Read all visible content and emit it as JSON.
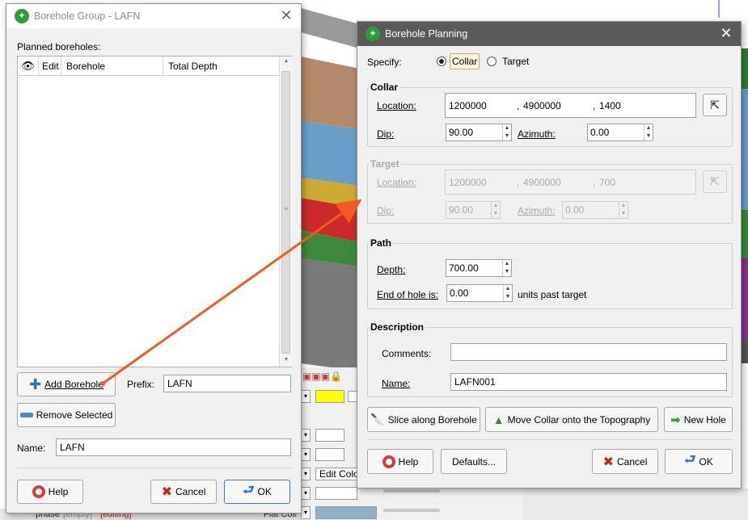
{
  "colors": {
    "accent_arrow": "#f05a23",
    "title_active": "#5a5a5a",
    "highlight_yellow": "#ffff00"
  },
  "bg_panel": {
    "edit_color_label": "Edit Colo",
    "phase_text": "phase",
    "empty_text": "[empty]",
    "editing_text": "[editing]",
    "flat_text": "Flat Coll"
  },
  "group_window": {
    "title": "Borehole Group - LAFN",
    "planned_label": "Planned boreholes:",
    "columns": [
      "Edit",
      "Borehole",
      "Total Depth"
    ],
    "eye_icon": "eye-icon",
    "add_button": "Add Borehole",
    "prefix_label": "Prefix:",
    "prefix_value": "LAFN",
    "remove_button": "Remove Selected",
    "name_label": "Name:",
    "name_value": "LAFN",
    "help_button": "Help",
    "cancel_button": "Cancel",
    "ok_button": "OK"
  },
  "planning_window": {
    "title": "Borehole Planning",
    "specify_label": "Specify:",
    "collar_option": "Collar",
    "target_option": "Target",
    "specify_selected": "Collar",
    "collar": {
      "heading": "Collar",
      "location_label": "Location:",
      "x": "1200000",
      "y": "4900000",
      "z": "1400",
      "dip_label": "Dip:",
      "dip": "90.00",
      "azimuth_label": "Azimuth:",
      "azimuth": "0.00"
    },
    "target": {
      "heading": "Target",
      "location_label": "Location:",
      "x": "1200000",
      "y": "4900000",
      "z": "700",
      "dip_label": "Dip:",
      "dip": "90.00",
      "azimuth_label": "Azimuth:",
      "azimuth": "0.00"
    },
    "path": {
      "heading": "Path",
      "depth_label": "Depth:",
      "depth": "700.00",
      "end_label": "End of hole is:",
      "end_value": "0.00",
      "units_label": "units past target"
    },
    "description": {
      "heading": "Description",
      "comments_label": "Comments:",
      "comments_value": "",
      "name_label": "Name:",
      "name_value": "LAFN001"
    },
    "slice_button": "Slice along Borehole",
    "move_button": "Move Collar onto the Topography",
    "new_hole_button": "New Hole",
    "help_button": "Help",
    "defaults_button": "Defaults...",
    "cancel_button": "Cancel",
    "ok_button": "OK"
  }
}
